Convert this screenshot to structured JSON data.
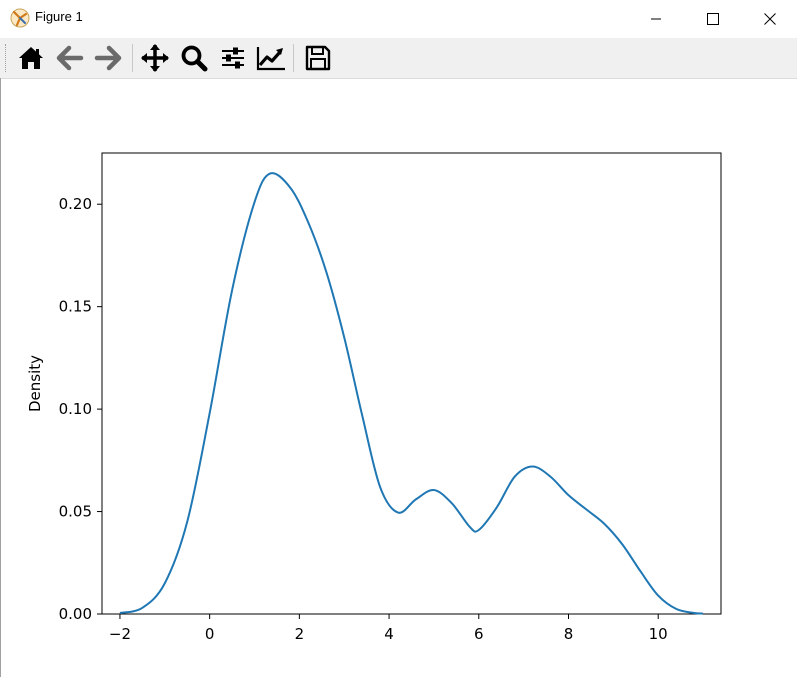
{
  "window": {
    "title": "Figure 1",
    "app_icon": "matplotlib-icon",
    "controls": [
      "minimize-icon",
      "maximize-icon",
      "close-icon"
    ]
  },
  "toolbar": {
    "buttons": [
      "home-icon",
      "back-arrow-icon",
      "forward-arrow-icon",
      "pan-move-icon",
      "zoom-magnifier-icon",
      "configure-subplots-icon",
      "edit-axis-icon",
      "save-floppy-icon"
    ]
  },
  "chart_data": {
    "type": "line",
    "title": "",
    "xlabel": "",
    "ylabel": "Density",
    "xlim": [
      -2.4,
      11.4
    ],
    "ylim": [
      0,
      0.225
    ],
    "xticks": [
      -2,
      0,
      2,
      4,
      6,
      8,
      10
    ],
    "xtick_labels": [
      "−2",
      "0",
      "2",
      "4",
      "6",
      "8",
      "10"
    ],
    "yticks": [
      0.0,
      0.05,
      0.1,
      0.15,
      0.2
    ],
    "ytick_labels": [
      "0.00",
      "0.05",
      "0.10",
      "0.15",
      "0.20"
    ],
    "grid": false,
    "color": "#1f77b4",
    "series": [
      {
        "x": [
          -2.0,
          -1.5,
          -1.0,
          -0.5,
          0.0,
          0.5,
          1.0,
          1.35,
          1.8,
          2.2,
          2.6,
          3.0,
          3.4,
          3.8,
          4.2,
          4.6,
          5.0,
          5.4,
          5.8,
          6.0,
          6.4,
          6.8,
          7.2,
          7.6,
          8.0,
          8.4,
          8.8,
          9.2,
          9.6,
          10.0,
          10.4,
          10.8,
          11.0
        ],
        "y": [
          0.0005,
          0.003,
          0.015,
          0.045,
          0.098,
          0.158,
          0.201,
          0.215,
          0.208,
          0.191,
          0.167,
          0.135,
          0.097,
          0.062,
          0.0495,
          0.056,
          0.0605,
          0.054,
          0.0425,
          0.041,
          0.052,
          0.067,
          0.072,
          0.067,
          0.058,
          0.051,
          0.044,
          0.034,
          0.021,
          0.009,
          0.0025,
          0.0005,
          0.0002
        ]
      }
    ]
  }
}
